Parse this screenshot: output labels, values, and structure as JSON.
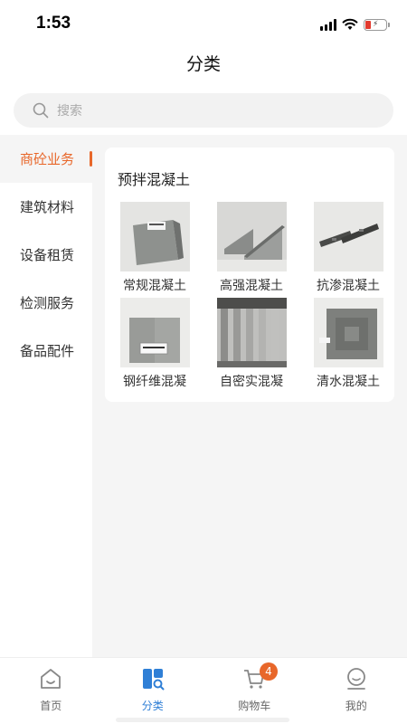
{
  "status_bar": {
    "time": "1:53"
  },
  "header": {
    "title": "分类"
  },
  "search": {
    "placeholder": "搜索"
  },
  "sidebar": {
    "items": [
      {
        "label": "商砼业务",
        "active": true
      },
      {
        "label": "建筑材料",
        "active": false
      },
      {
        "label": "设备租赁",
        "active": false
      },
      {
        "label": "检测服务",
        "active": false
      },
      {
        "label": "备品配件",
        "active": false
      }
    ]
  },
  "panel": {
    "title": "预拌混凝土",
    "products": [
      {
        "label": "常规混凝土",
        "image": "gray-concrete-block"
      },
      {
        "label": "高强混凝土",
        "image": "concrete-wedges"
      },
      {
        "label": "抗渗混凝土",
        "image": "dark-concrete-bars"
      },
      {
        "label": "钢纤维混凝",
        "image": "concrete-block-with-tag"
      },
      {
        "label": "自密实混凝",
        "image": "colonnade-pillars"
      },
      {
        "label": "清水混凝土",
        "image": "concrete-panel-frame"
      }
    ]
  },
  "tabbar": {
    "items": [
      {
        "label": "首页",
        "icon": "home-icon",
        "active": false
      },
      {
        "label": "分类",
        "icon": "category-icon",
        "active": true
      },
      {
        "label": "购物车",
        "icon": "cart-icon",
        "active": false,
        "badge": "4"
      },
      {
        "label": "我的",
        "icon": "profile-icon",
        "active": false
      }
    ]
  },
  "colors": {
    "accent": "#e8672a",
    "active_tab": "#2f7fd6",
    "background": "#f5f5f5"
  }
}
